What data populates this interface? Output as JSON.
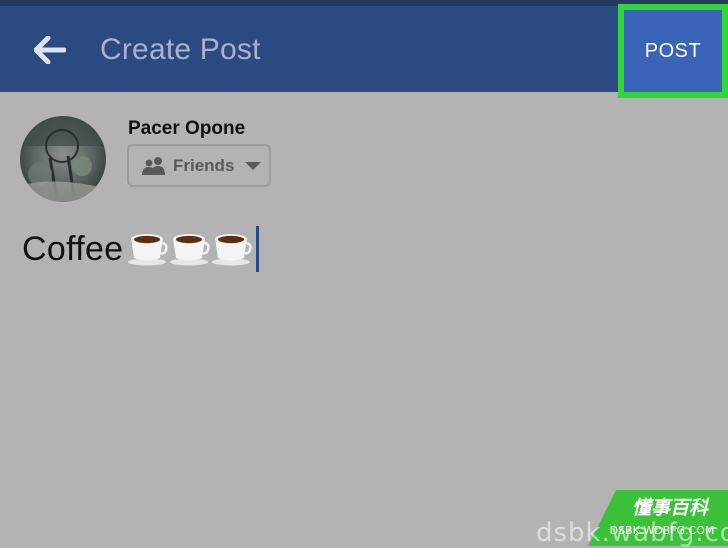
{
  "header": {
    "title": "Create Post",
    "post_label": "POST",
    "colors": {
      "bar": "#2c4a82",
      "post_button": "#3a64b8",
      "highlight_frame": "#31d63a"
    }
  },
  "composer": {
    "user_name": "Pacer Opone",
    "audience": "Friends",
    "text": "Coffee",
    "emoji_count": 3
  },
  "watermark": {
    "cn_text": "懂事百科",
    "url_small": "DSBK.WDBFG.COM",
    "url_large": "dsbk.wabfg.com"
  }
}
